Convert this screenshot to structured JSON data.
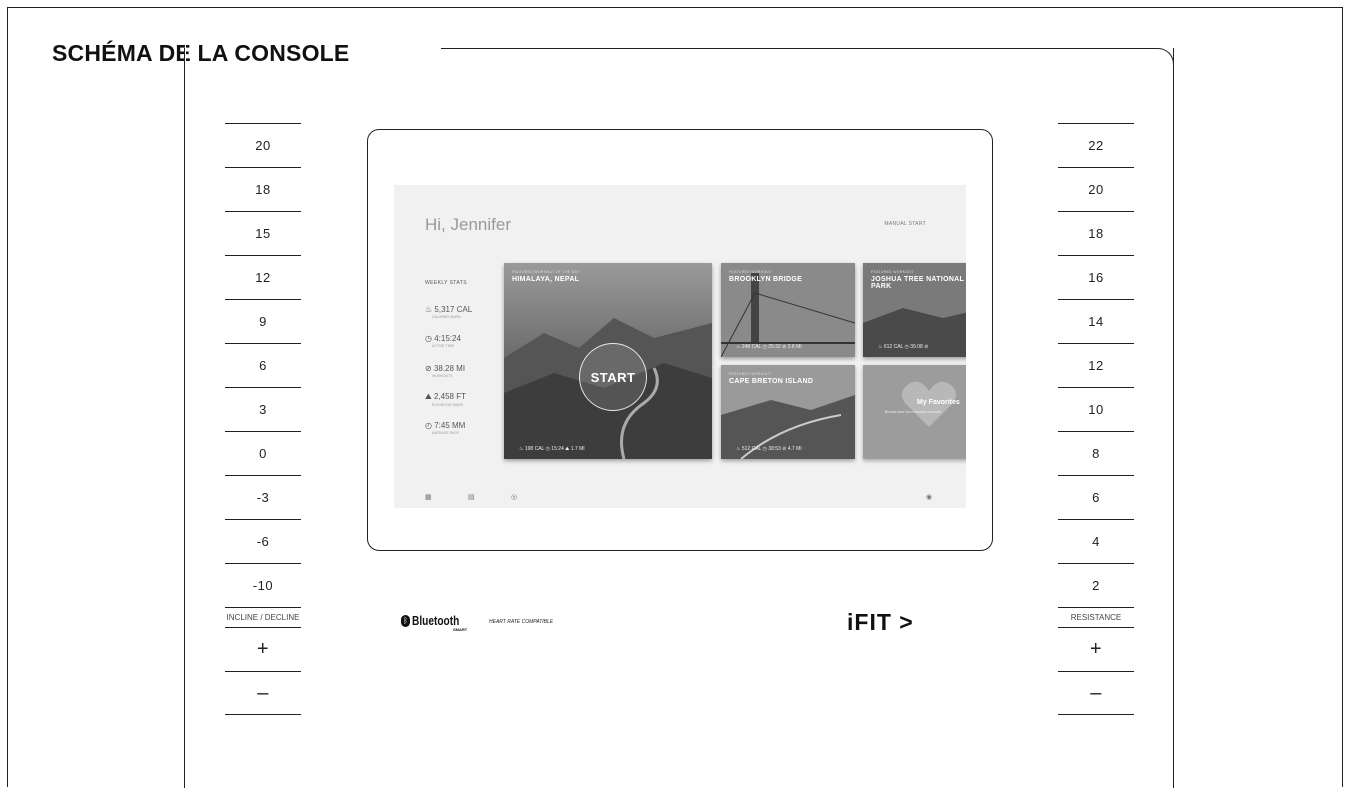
{
  "page": {
    "title": "SCHÉMA DE LA CONSOLE"
  },
  "incline_panel": {
    "values": [
      "20",
      "18",
      "15",
      "12",
      "9",
      "6",
      "3",
      "0",
      "-3",
      "-6",
      "-10"
    ],
    "label": "INCLINE / DECLINE",
    "plus": "+",
    "minus": "–"
  },
  "resistance_panel": {
    "values": [
      "22",
      "20",
      "18",
      "16",
      "14",
      "12",
      "10",
      "8",
      "6",
      "4",
      "2"
    ],
    "label": "RESISTANCE",
    "plus": "+",
    "minus": "–"
  },
  "screen": {
    "greeting": "Hi, Jennifer",
    "manual_start": "MANUAL START",
    "weekly_stats": {
      "title": "WEEKLY STATS",
      "items": [
        {
          "icon": "flame-icon",
          "value": "5,317 CAL",
          "sub": "CALORIES BURN"
        },
        {
          "icon": "clock-icon",
          "value": "4:15:24",
          "sub": "ACTIVE TIME"
        },
        {
          "icon": "distance-icon",
          "value": "38.28 MI",
          "sub": "WORKOUTS"
        },
        {
          "icon": "elevation-icon",
          "value": "2,458 FT",
          "sub": "ELEVATION GAINS"
        },
        {
          "icon": "pace-icon",
          "value": "7:45 MM",
          "sub": "AVERAGE PACE"
        }
      ]
    },
    "featured": {
      "kicker": "FEATURED WORKOUT OF THE DAY",
      "name": "HIMALAYA, NEPAL",
      "start": "START",
      "meta": "♨ 198 CAL   ◷ 15:24   ⛰ 1.7 MI"
    },
    "cards": [
      {
        "kicker": "FEATURED WORKOUT",
        "name": "BROOKLYN BRIDGE",
        "meta": "♨ 248 CAL   ◷ 25:32   ⊘ 2.8 MI"
      },
      {
        "kicker": "FEATURED WORKOUT",
        "name": "JOSHUA TREE NATIONAL PARK",
        "meta": "♨ 612 CAL   ◷ 35:08   ⊘"
      },
      {
        "kicker": "FEATURED WORKOUT",
        "name": "CAPE BRETON ISLAND",
        "meta": "♨ 512 CAL   ◷ 38:53   ⊘ 4.7 MI"
      }
    ],
    "favorites": {
      "title": "My Favorites",
      "sub": "Browse your list of favorite workouts"
    }
  },
  "logos": {
    "bluetooth_word": "Bluetooth",
    "bluetooth_smart": "SMART",
    "bluetooth_compat": "HEART RATE COMPATIBLE",
    "ifit": "iFIT >"
  }
}
